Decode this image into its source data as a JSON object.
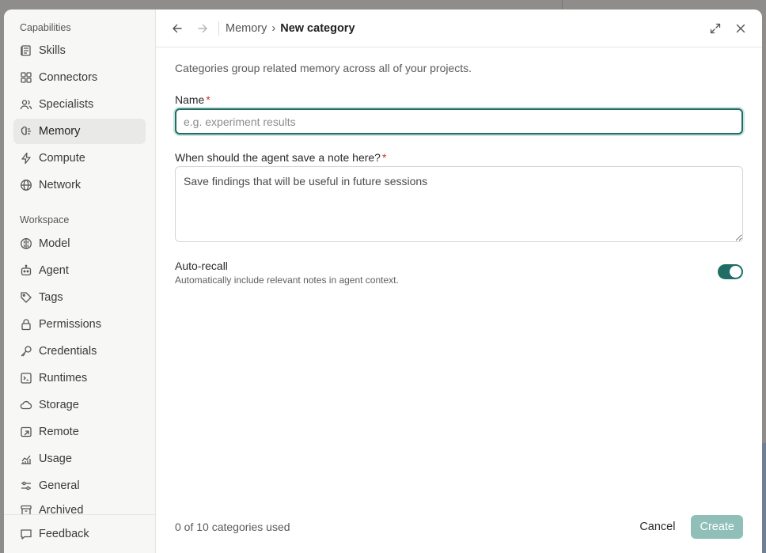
{
  "sidebar": {
    "capabilities_label": "Capabilities",
    "capabilities": [
      {
        "label": "Skills",
        "icon": "skills-icon"
      },
      {
        "label": "Connectors",
        "icon": "connectors-icon"
      },
      {
        "label": "Specialists",
        "icon": "specialists-icon"
      },
      {
        "label": "Memory",
        "icon": "memory-icon",
        "active": true
      },
      {
        "label": "Compute",
        "icon": "compute-icon"
      },
      {
        "label": "Network",
        "icon": "network-icon"
      }
    ],
    "workspace_label": "Workspace",
    "workspace": [
      {
        "label": "Model",
        "icon": "model-icon"
      },
      {
        "label": "Agent",
        "icon": "agent-icon"
      },
      {
        "label": "Tags",
        "icon": "tag-icon"
      },
      {
        "label": "Permissions",
        "icon": "lock-icon"
      },
      {
        "label": "Credentials",
        "icon": "key-icon"
      },
      {
        "label": "Runtimes",
        "icon": "terminal-icon"
      },
      {
        "label": "Storage",
        "icon": "cloud-icon"
      },
      {
        "label": "Remote",
        "icon": "remote-icon"
      },
      {
        "label": "Usage",
        "icon": "chart-icon"
      },
      {
        "label": "General",
        "icon": "sliders-icon"
      },
      {
        "label": "Archived",
        "icon": "archive-icon"
      }
    ],
    "feedback_label": "Feedback"
  },
  "topbar": {
    "breadcrumb_parent": "Memory",
    "breadcrumb_separator": "›",
    "breadcrumb_current": "New category"
  },
  "form": {
    "description": "Categories group related memory across all of your projects.",
    "name_label": "Name",
    "required_mark": "*",
    "name_placeholder": "e.g. experiment results",
    "name_value": "",
    "note_label": "When should the agent save a note here?",
    "note_value": "Save findings that will be useful in future sessions",
    "auto_recall_title": "Auto-recall",
    "auto_recall_description": "Automatically include relevant notes in agent context.",
    "auto_recall_enabled": true
  },
  "footer": {
    "usage_text": "0 of 10 categories used",
    "cancel_label": "Cancel",
    "create_label": "Create"
  },
  "colors": {
    "accent": "#1f6d64",
    "create_disabled": "#8fbfb8",
    "required": "#d0342c"
  }
}
